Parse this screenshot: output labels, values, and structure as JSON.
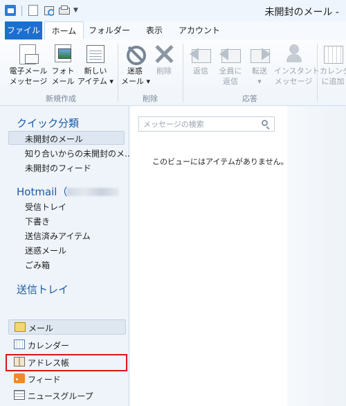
{
  "window": {
    "title": "未開封のメール -"
  },
  "ribbon_tabs": [
    "ファイル",
    "ホーム",
    "フォルダー",
    "表示",
    "アカウント"
  ],
  "ribbon": {
    "new_group": {
      "label": "新規作成",
      "email": [
        "電子メール",
        "メッセージ"
      ],
      "photo": [
        "フォト",
        "メール"
      ],
      "new_item": [
        "新しい",
        "アイテム ▾"
      ]
    },
    "delete_group": {
      "label": "削除",
      "junk": [
        "迷惑",
        "メール ▾"
      ],
      "delete": "削除"
    },
    "respond_group": {
      "label": "応答",
      "reply": "返信",
      "reply_all": [
        "全員に",
        "返信"
      ],
      "forward": [
        "転送",
        "▾"
      ],
      "instant": [
        "インスタント",
        "メッセージ"
      ]
    },
    "calendar_add": [
      "カレンダー",
      "に追加"
    ]
  },
  "nav": {
    "quick_views": {
      "header": "クイック分類",
      "items": [
        "未開封のメール",
        "知り合いからの未開封のメ…",
        "未開封のフィード"
      ]
    },
    "hotmail": {
      "header": "Hotmail（",
      "items": [
        "受信トレイ",
        "下書き",
        "送信済みアイテム",
        "迷惑メール",
        "ごみ箱"
      ]
    },
    "outbox": "送信トレイ",
    "modules": [
      {
        "label": "メール",
        "icon": "mail-icon"
      },
      {
        "label": "カレンダー",
        "icon": "calendar-icon"
      },
      {
        "label": "アドレス帳",
        "icon": "address-book-icon"
      },
      {
        "label": "フィード",
        "icon": "rss-feed-icon"
      },
      {
        "label": "ニュースグループ",
        "icon": "newsgroup-icon"
      }
    ]
  },
  "content": {
    "search_placeholder": "メッセージの検索",
    "empty_message": "このビューにはアイテムがありません。"
  },
  "colors": {
    "accent": "#1b6fcf",
    "highlight_box": "#e01018"
  }
}
